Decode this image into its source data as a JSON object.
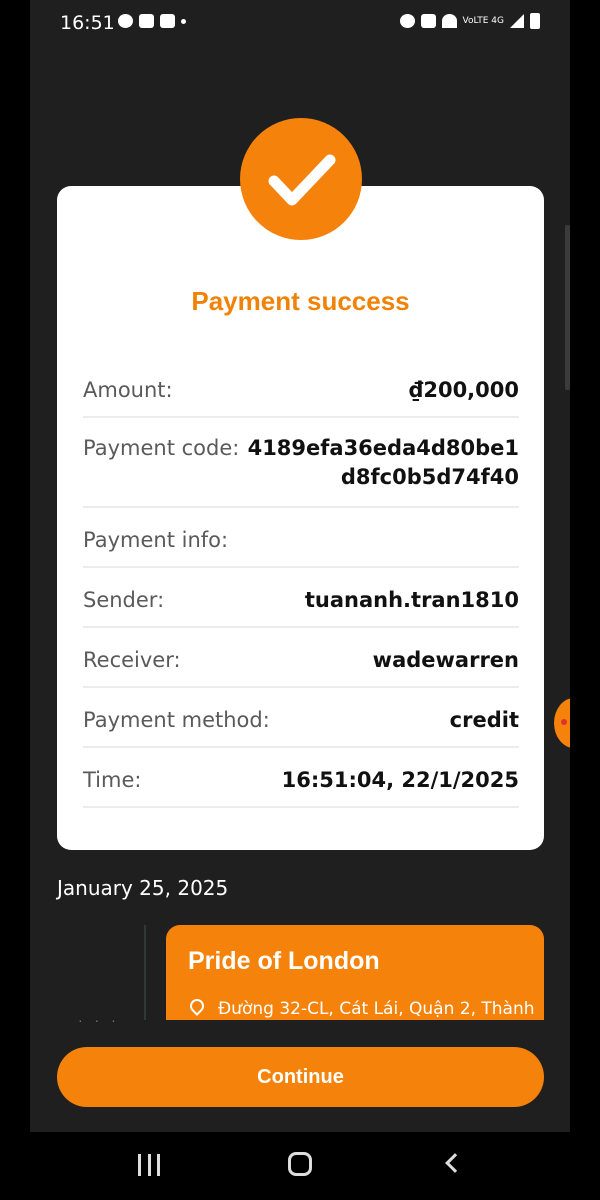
{
  "status_bar": {
    "time": "16:51",
    "network_label": "VoLTE 4G"
  },
  "modal": {
    "title": "Payment success",
    "rows": [
      {
        "label": "Amount:",
        "value": "₫200,000"
      },
      {
        "label": "Payment code:",
        "value": "4189efa36eda4d80be1d8fc0b5d74f40"
      },
      {
        "label": "Payment info:",
        "value": ""
      },
      {
        "label": "Sender:",
        "value": "tuananh.tran1810"
      },
      {
        "label": "Receiver:",
        "value": "wadewarren"
      },
      {
        "label": "Payment method:",
        "value": "credit"
      },
      {
        "label": "Time:",
        "value": "16:51:04, 22/1/2025"
      }
    ],
    "continue_label": "Continue"
  },
  "background": {
    "date_heading": "January 25, 2025",
    "event": {
      "title": "Pride of London",
      "address": "Đường 32-CL, Cát Lái, Quận 2, Thành"
    }
  },
  "colors": {
    "accent": "#f5820a",
    "title": "#f08307",
    "background": "#1e1f1e"
  }
}
